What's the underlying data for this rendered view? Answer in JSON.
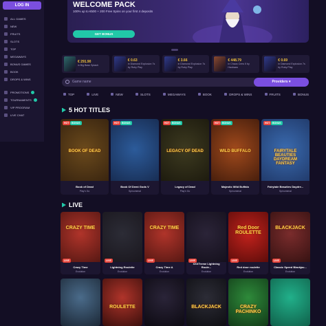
{
  "sidebar": {
    "login_label": "LOG IN",
    "items": [
      "ALL GAMES",
      "NEW",
      "FRUITS",
      "SLOTS",
      "TOP",
      "MEGAWAYS",
      "BONUS GAMES",
      "BOOK",
      "DROPS & WINS"
    ],
    "extra": [
      "PROMOTIONS",
      "TOURNAMENTS",
      "VIP PROGRAM",
      "LIVE CHAT"
    ]
  },
  "banner": {
    "title": "WELCOME PACK",
    "subtitle": "100% up to €500 + 200 Free Spins on your first 4 deposits",
    "cta": "GET BONUS"
  },
  "recent_wins": [
    {
      "amount": "€ 291.90",
      "text": "in Big Bass Splash",
      "color": "#2d6a6a"
    },
    {
      "amount": "€ 0.63",
      "text": "in Diamond Explosion 7s by Ruby Play",
      "color": "#2f3a8a"
    },
    {
      "amount": "€ 3.66",
      "text": "in Diamond Explosion 7s by Ruby Play",
      "color": "#2f3a8a"
    },
    {
      "amount": "€ 448.79",
      "text": "in Chaos Crew II by Hacksaw",
      "color": "#8a4a2f"
    },
    {
      "amount": "€ 0.69",
      "text": "in Diamond Explosion 7s by Ruby Play",
      "color": "#2f3a8a"
    }
  ],
  "search": {
    "placeholder": "Game name",
    "providers_label": "Providers"
  },
  "categories": [
    "TOP",
    "LIVE",
    "NEW",
    "SLOTS",
    "MEGAWAYS",
    "BOOK",
    "DROPS & WINS",
    "FRUITS",
    "BONUS"
  ],
  "hot": {
    "title": "5 HOT TITLES",
    "games": [
      {
        "name": "Book of Dead",
        "provider": "Play'n Go",
        "tag": "HOT",
        "tag2": "BONUS",
        "c1": "#6b4a1c",
        "c2": "#2b1a0c",
        "art": "BOOK OF DEAD"
      },
      {
        "name": "Book Of Demi Gods V",
        "provider": "Spinomenal",
        "tag": "HOT",
        "tag2": "BONUS",
        "c1": "#2c5b9a",
        "c2": "#12203f",
        "art": ""
      },
      {
        "name": "Legacy of Dead",
        "provider": "Play'n Go",
        "tag": "HOT",
        "tag2": "BONUS",
        "c1": "#3d3a20",
        "c2": "#141209",
        "art": "LEGACY OF DEAD"
      },
      {
        "name": "Majestic Wild Buffalo",
        "provider": "Spinomenal",
        "tag": "HOT",
        "tag2": "BONUS",
        "c1": "#a14a1c",
        "c2": "#2e1208",
        "art": "WILD BUFFALO"
      },
      {
        "name": "Fairytale Beauties Daydre...",
        "provider": "Spinomenal",
        "tag": "HOT",
        "tag2": "BONUS",
        "c1": "#3a6bb0",
        "c2": "#1a2d58",
        "art": "FAIRYTALE BEAUTIES DAYDREAM FANTASY"
      }
    ]
  },
  "live": {
    "title": "LIVE",
    "tables": [
      {
        "name": "Crazy Time",
        "provider": "Evolution",
        "c1": "#b0342a",
        "c2": "#3a0f0c",
        "art": "CRAZY TIME"
      },
      {
        "name": "Lightning Roulette",
        "provider": "Evolution",
        "c1": "#2c2c36",
        "c2": "#141016",
        "art": ""
      },
      {
        "name": "Crazy Time A",
        "provider": "Evolution",
        "c1": "#b0342a",
        "c2": "#3a0f0c",
        "art": "CRAZY TIME"
      },
      {
        "name": "XXXTreme Lightning Roule...",
        "provider": "Evolution",
        "c1": "#2b2438",
        "c2": "#0e0a14",
        "art": ""
      },
      {
        "name": "Red door roulette",
        "provider": "Evolution",
        "c1": "#c2221c",
        "c2": "#3e0605",
        "art": "Red Door ROULETTE"
      },
      {
        "name": "Classic Speed Blackjac...",
        "provider": "Evolution",
        "c1": "#7a2c2c",
        "c2": "#210a0a",
        "art": "BLACKJACK"
      }
    ],
    "row2": [
      {
        "c1": "#4a6b8a",
        "c2": "#1c2836",
        "art": ""
      },
      {
        "c1": "#b0342a",
        "c2": "#3a0f0c",
        "art": "ROULETTE"
      },
      {
        "c1": "#2a2438",
        "c2": "#0d0a12",
        "art": ""
      },
      {
        "c1": "#2c2c36",
        "c2": "#0e0e12",
        "art": "BLACKJACK"
      },
      {
        "c1": "#2e8a3a",
        "c2": "#123a18",
        "art": "CRAZY PACHINKO"
      },
      {
        "c1": "#21b08a",
        "c2": "#10604a",
        "art": ""
      }
    ],
    "live_label": "LIVE"
  }
}
